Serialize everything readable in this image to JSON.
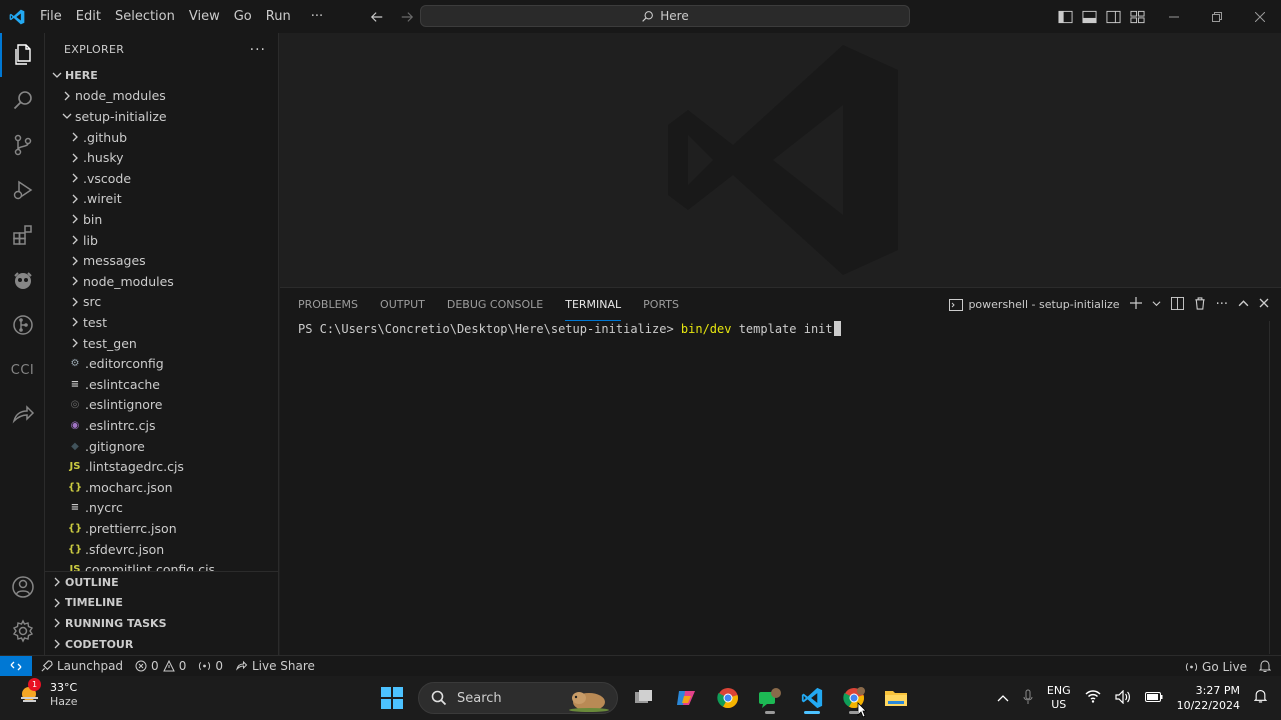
{
  "titlebar": {
    "menu": [
      "File",
      "Edit",
      "Selection",
      "View",
      "Go",
      "Run"
    ],
    "more": "···",
    "command_center": "Here"
  },
  "activity_bar": {
    "items": [
      "explorer-icon",
      "search-icon",
      "source-control-icon",
      "run-debug-icon",
      "extensions-icon",
      "copilot-icon",
      "gitlens-icon",
      "cci-label",
      "live-share-icon",
      "accounts-icon",
      "manage-gear-icon"
    ],
    "cci_label": "CCI"
  },
  "sidebar": {
    "title": "EXPLORER",
    "more": "···",
    "root": "HERE",
    "tree": [
      {
        "label": "node_modules",
        "depth": 1,
        "kind": "folder",
        "open": false
      },
      {
        "label": "setup-initialize",
        "depth": 1,
        "kind": "folder",
        "open": true
      },
      {
        "label": ".github",
        "depth": 2,
        "kind": "folder",
        "open": false
      },
      {
        "label": ".husky",
        "depth": 2,
        "kind": "folder",
        "open": false
      },
      {
        "label": ".vscode",
        "depth": 2,
        "kind": "folder",
        "open": false
      },
      {
        "label": ".wireit",
        "depth": 2,
        "kind": "folder",
        "open": false
      },
      {
        "label": "bin",
        "depth": 2,
        "kind": "folder",
        "open": false
      },
      {
        "label": "lib",
        "depth": 2,
        "kind": "folder",
        "open": false
      },
      {
        "label": "messages",
        "depth": 2,
        "kind": "folder",
        "open": false
      },
      {
        "label": "node_modules",
        "depth": 2,
        "kind": "folder",
        "open": false
      },
      {
        "label": "src",
        "depth": 2,
        "kind": "folder",
        "open": false
      },
      {
        "label": "test",
        "depth": 2,
        "kind": "folder",
        "open": false
      },
      {
        "label": "test_gen",
        "depth": 2,
        "kind": "folder",
        "open": false
      },
      {
        "label": ".editorconfig",
        "depth": 2,
        "kind": "file",
        "icon": "⚙",
        "color": "#9aa7b0"
      },
      {
        "label": ".eslintcache",
        "depth": 2,
        "kind": "file",
        "icon": "≡",
        "color": "#cccccc"
      },
      {
        "label": ".eslintignore",
        "depth": 2,
        "kind": "file",
        "icon": "◎",
        "color": "#6d6d6d"
      },
      {
        "label": ".eslintrc.cjs",
        "depth": 2,
        "kind": "file",
        "icon": "◉",
        "color": "#a074c4"
      },
      {
        "label": ".gitignore",
        "depth": 2,
        "kind": "file",
        "icon": "◆",
        "color": "#41535b"
      },
      {
        "label": ".lintstagedrc.cjs",
        "depth": 2,
        "kind": "file",
        "icon": "JS",
        "color": "#cbcb41"
      },
      {
        "label": ".mocharc.json",
        "depth": 2,
        "kind": "file",
        "icon": "{}",
        "color": "#cbcb41"
      },
      {
        "label": ".nycrc",
        "depth": 2,
        "kind": "file",
        "icon": "≡",
        "color": "#cccccc"
      },
      {
        "label": ".prettierrc.json",
        "depth": 2,
        "kind": "file",
        "icon": "{}",
        "color": "#cbcb41"
      },
      {
        "label": ".sfdevrc.json",
        "depth": 2,
        "kind": "file",
        "icon": "{}",
        "color": "#cbcb41"
      },
      {
        "label": "commitlint.config.cjs",
        "depth": 2,
        "kind": "file",
        "icon": "JS",
        "color": "#cbcb41"
      }
    ],
    "panes": [
      "OUTLINE",
      "TIMELINE",
      "RUNNING TASKS",
      "CODETOUR"
    ]
  },
  "panel": {
    "tabs": [
      "PROBLEMS",
      "OUTPUT",
      "DEBUG CONSOLE",
      "TERMINAL",
      "PORTS"
    ],
    "active_tab": "TERMINAL",
    "terminal_name": "powershell - setup-initialize",
    "prompt": "PS C:\\Users\\Concretio\\Desktop\\Here\\setup-initialize> ",
    "command": "bin/dev",
    "args": " template init"
  },
  "statusbar": {
    "launchpad": "Launchpad",
    "errors": "0",
    "warnings": "0",
    "ports": "0",
    "live_share": "Live Share",
    "go_live": "Go Live"
  },
  "taskbar": {
    "temperature": "33°C",
    "condition": "Haze",
    "weather_badge": "1",
    "search_placeholder": "Search",
    "lang_top": "ENG",
    "lang_bottom": "US",
    "time": "3:27 PM",
    "date": "10/22/2024"
  },
  "colors": {
    "accent": "#0078d4",
    "background": "#1f1f1f",
    "chrome": "#181818",
    "terminal_command": "#e5e510"
  }
}
